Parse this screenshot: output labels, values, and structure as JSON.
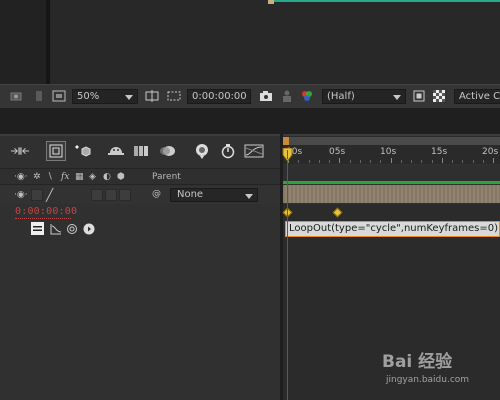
{
  "viewer_toolbar": {
    "zoom": "50%",
    "timecode": "0:00:00:00",
    "resolution": "(Half)",
    "camera_view": "Active C"
  },
  "timeline": {
    "tools": [
      "compact-icon",
      "composition-mini-flowchart-icon",
      "draft-3d-icon",
      "shy-icon",
      "frame-blending-icon",
      "motion-blur-icon",
      "brainstorm-icon",
      "auto-keyframe-icon",
      "graph-editor-icon"
    ],
    "header": {
      "parent_label": "Parent"
    },
    "layer": {
      "parent_value": "None"
    },
    "current_time": "0:00:00:00",
    "ruler": {
      "labels": [
        "00s",
        "05s",
        "10s",
        "15s",
        "20s"
      ]
    },
    "expression": "LoopOut(type=\"cycle\",numKeyframes=0)"
  },
  "colors": {
    "accent_orange": "#e08a2a",
    "keyframe": "#e8c23a",
    "playhead": "#dd2222",
    "layer_bar": "#8c7f6b",
    "timecode": "#c44545",
    "track_green": "#2ea43a"
  },
  "watermark": {
    "logo": "Bai 经验",
    "url": "jingyan.baidu.com"
  }
}
